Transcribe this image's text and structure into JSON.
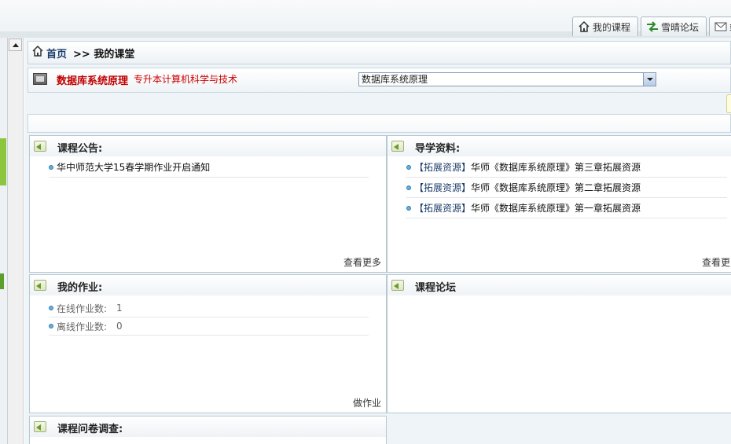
{
  "top_tabs": [
    {
      "label": "我的课程",
      "icon": "home-icon"
    },
    {
      "label": "雪晴论坛",
      "icon": "arrows-icon"
    },
    {
      "label": "站",
      "icon": "mail-icon"
    }
  ],
  "breadcrumb": {
    "home": "首页",
    "current": ">> 我的课堂"
  },
  "course": {
    "name": "数据库系统原理",
    "major": "专升本计算机科学与技术",
    "select_value": "数据库系统原理"
  },
  "panels": {
    "notice": {
      "title": "课程公告:",
      "items": [
        "华中师范大学15春学期作业开启通知"
      ],
      "more": "查看更多"
    },
    "guide": {
      "title": "导学资料:",
      "items": [
        {
          "tag": "【拓展资源】",
          "text": "华师《数据库系统原理》第三章拓展资源"
        },
        {
          "tag": "【拓展资源】",
          "text": "华师《数据库系统原理》第二章拓展资源"
        },
        {
          "tag": "【拓展资源】",
          "text": "华师《数据库系统原理》第一章拓展资源"
        }
      ],
      "more": "查看更多"
    },
    "homework": {
      "title": "我的作业:",
      "items": [
        {
          "label": "在线作业数:",
          "value": "1"
        },
        {
          "label": "离线作业数:",
          "value": "0"
        }
      ],
      "action": "做作业"
    },
    "forum": {
      "title": "课程论坛"
    },
    "survey": {
      "title": "课程问卷调查:"
    }
  }
}
